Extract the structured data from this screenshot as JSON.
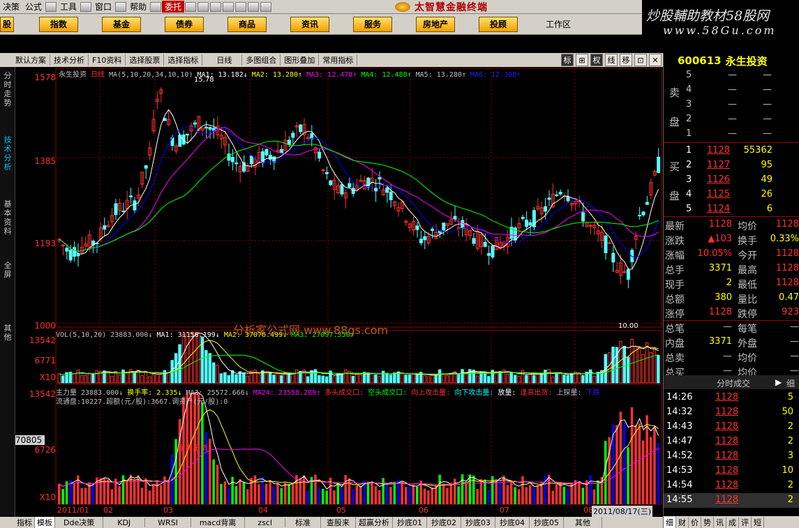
{
  "menubar": {
    "items": [
      "决策",
      "公式",
      "工具",
      "窗口",
      "帮助",
      "委托"
    ],
    "title": "太智慧金融终端"
  },
  "watermark": {
    "line1": "炒股輔助教材58股网",
    "line2": "www.58Gu.com"
  },
  "toolbar": {
    "buttons": [
      "股",
      "指数",
      "基金",
      "债券",
      "商品",
      "资讯",
      "服务",
      "房地产",
      "投顾"
    ],
    "workarea": "工作区"
  },
  "chart_toolbar": {
    "items": [
      "默认方案",
      "技术分析",
      "F10资料",
      "选择股票",
      "选择指标",
      "日线",
      "多图组合",
      "图形叠加",
      "常用指标"
    ],
    "right": [
      "标",
      "权",
      "线",
      "移"
    ]
  },
  "left_tabs": [
    "分时走势",
    "技术分析",
    "基本资料",
    "全屏",
    "其他"
  ],
  "main_legend": {
    "name": "永生投资",
    "period": "日线",
    "ma": "MA(5,10,20,34,10,10)",
    "ma1": "MA1: 13.182↓",
    "ma2": "MA2: 13.280↑",
    "ma3": "MA3: 12.478↑",
    "ma4": "MA4: 12.488↑",
    "ma5": "MA5: 13.280↑",
    "ma6": "MA6: 12.308↑"
  },
  "vol_legend": {
    "vol": "VOL(5,10,20) 23883.000↓",
    "ma1": "MA1: 31156.199↓",
    "ma2": "MA2: 37076.499↓",
    "ma3": "MA3: 27097.350↑"
  },
  "flow_legend": {
    "line1a": "主力量 23883.000↓",
    "line1b": "换手率: 2.335↓",
    "line1c": "MA3: 25572.666↓",
    "line1d": "MA24: 23558.209↑",
    "line1e": "多头成交口:",
    "line1f": "空头成交口:",
    "line1g": "向上攻击量:",
    "line1h": "向下攻击量:",
    "line1i": "放量:",
    "line1j": "逢高出货:",
    "line1k": "上探量:",
    "line1l": "下跌",
    "line2": "流通盘:10227.超额(元/股):3667.调资产(元/股):0",
    "annotation": "逢高出货"
  },
  "chart_watermark": "分析家公式网 www.88gs.com",
  "price_axis": [
    "1578",
    "1385",
    "1193",
    "1000"
  ],
  "vol_axis": [
    "13542",
    "6771",
    "X10"
  ],
  "flow_axis": [
    "13542",
    "6726",
    "X10"
  ],
  "flow_highlight": "70805",
  "high_label": "15.78",
  "low_label": "10.00",
  "date_axis": [
    "2011/01",
    "02",
    "03",
    "04",
    "05",
    "06",
    "07",
    "08"
  ],
  "date_cursor": "2011/08/17(三)",
  "bottom_tabs": [
    "日线",
    "指标",
    "模板",
    "Dde决策",
    "KDJ",
    "WRSI",
    "macd背离",
    "zscl",
    "标准",
    "查股来",
    "超赢分析",
    "抄底01",
    "抄底02",
    "抄底03",
    "抄底04",
    "抄底05",
    "其他"
  ],
  "quote": {
    "code": "600613",
    "name": "永生投资",
    "sell_label1": "卖",
    "sell_label2": "盘",
    "buy_label1": "买",
    "buy_label2": "盘",
    "sells": [
      {
        "lvl": "5",
        "price": "—",
        "vol": "—"
      },
      {
        "lvl": "4",
        "price": "—",
        "vol": "—"
      },
      {
        "lvl": "3",
        "price": "—",
        "vol": "—"
      },
      {
        "lvl": "2",
        "price": "—",
        "vol": "—"
      },
      {
        "lvl": "1",
        "price": "—",
        "vol": "—"
      }
    ],
    "buys": [
      {
        "lvl": "1",
        "price": "1128",
        "vol": "55362"
      },
      {
        "lvl": "2",
        "price": "1127",
        "vol": "95"
      },
      {
        "lvl": "3",
        "price": "1126",
        "vol": "49"
      },
      {
        "lvl": "4",
        "price": "1125",
        "vol": "26"
      },
      {
        "lvl": "5",
        "price": "1124",
        "vol": "6"
      }
    ],
    "stats": [
      {
        "l": "最新",
        "lv": "1128",
        "r": "均价",
        "rv": "1128"
      },
      {
        "l": "涨跌",
        "lv": "▲103",
        "r": "换手",
        "rv": "0.33%"
      },
      {
        "l": "涨幅",
        "lv": "10.05%",
        "r": "今开",
        "rv": "1128"
      },
      {
        "l": "总手",
        "lv": "3371",
        "r": "最高",
        "rv": "1128"
      },
      {
        "l": "现手",
        "lv": "2",
        "r": "最低",
        "rv": "1128"
      },
      {
        "l": "总额",
        "lv": "380",
        "r": "量比",
        "rv": "0.47"
      },
      {
        "l": "涨停",
        "lv": "1128",
        "r": "跌停",
        "rv": "923"
      },
      {
        "l": "总笔",
        "lv": "—",
        "r": "每笔",
        "rv": "—"
      },
      {
        "l": "内盘",
        "lv": "3371",
        "r": "外盘",
        "rv": "—"
      },
      {
        "l": "总卖",
        "lv": "—",
        "r": "均价",
        "rv": "—"
      },
      {
        "l": "总买",
        "lv": "—",
        "r": "均价",
        "rv": "—"
      }
    ],
    "trades_title": "分时成交",
    "trades_tab": "细",
    "trades": [
      {
        "t": "14:26",
        "p": "1128",
        "v": "5"
      },
      {
        "t": "14:32",
        "p": "1128",
        "v": "50"
      },
      {
        "t": "14:43",
        "p": "1128",
        "v": "2"
      },
      {
        "t": "14:47",
        "p": "1128",
        "v": "2"
      },
      {
        "t": "14:52",
        "p": "1128",
        "v": "3"
      },
      {
        "t": "14:53",
        "p": "1128",
        "v": "10"
      },
      {
        "t": "14:54",
        "p": "1128",
        "v": "2"
      },
      {
        "t": "14:55",
        "p": "1128",
        "v": "2"
      }
    ],
    "tabs": [
      "细",
      "财",
      "价",
      "势",
      "讯",
      "成",
      "评",
      "短"
    ]
  },
  "colors": {
    "up": "#ff3232",
    "down": "#54fcfc",
    "ma1": "#ffffff",
    "ma2": "#ffff00",
    "ma3": "#ff00ff",
    "ma4": "#00ff00",
    "ma5": "#0000ff",
    "grid": "#8b0000"
  }
}
